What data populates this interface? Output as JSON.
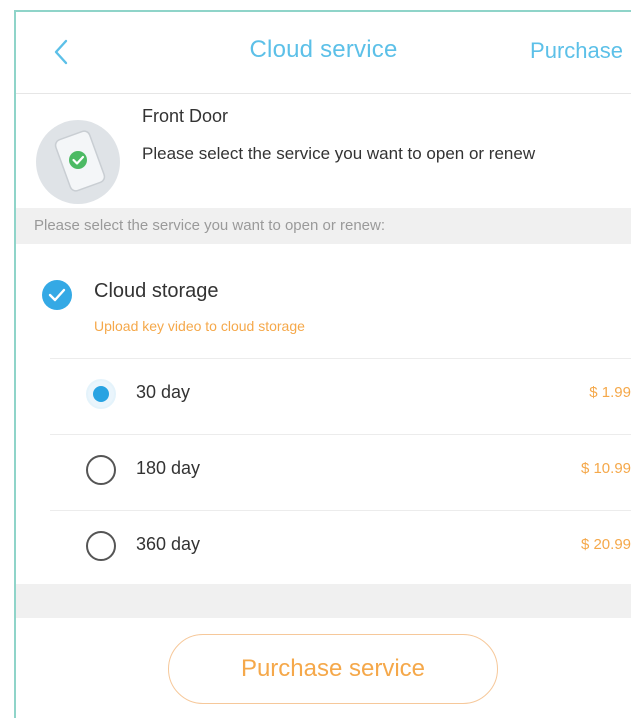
{
  "header": {
    "back_icon": "chevron-left-icon",
    "title": "Cloud service",
    "purchase_label": "Purchase"
  },
  "device": {
    "icon": "phone-check-icon",
    "name": "Front Door",
    "description": "Please select the service you want to open or renew"
  },
  "section_label": "Please select the service you want to open or renew:",
  "service": {
    "name": "Cloud storage",
    "description": "Upload key video to cloud storage",
    "selected": true
  },
  "plans": [
    {
      "label": "30 day",
      "price": "$ 1.99",
      "selected": true
    },
    {
      "label": "180 day",
      "price": "$ 10.99",
      "selected": false
    },
    {
      "label": "360 day",
      "price": "$ 20.99",
      "selected": false
    }
  ],
  "footer": {
    "button_label": "Purchase service"
  },
  "colors": {
    "accent": "#5cc0e8",
    "check": "#34a9e5",
    "price": "#f5a84a",
    "section_bg": "#f0f0f0"
  }
}
